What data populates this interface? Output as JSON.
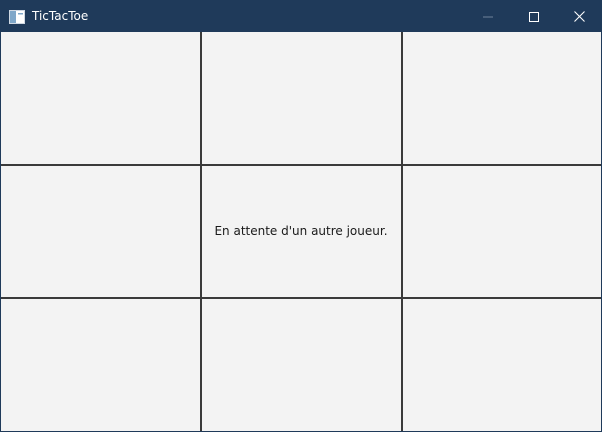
{
  "window": {
    "title": "TicTacToe",
    "titlebar_color": "#1f3a5a",
    "background_color": "#f3f3f3",
    "icons": {
      "app": "app-window-icon",
      "minimize": "minimize-icon",
      "maximize": "maximize-icon",
      "close": "close-icon"
    }
  },
  "board": {
    "rows": 3,
    "columns": 3,
    "grid_color": "#3a3a3a",
    "cells": [
      "",
      "",
      "",
      "",
      "",
      "",
      "",
      "",
      ""
    ],
    "status_message": "En attente d'un autre joueur."
  }
}
